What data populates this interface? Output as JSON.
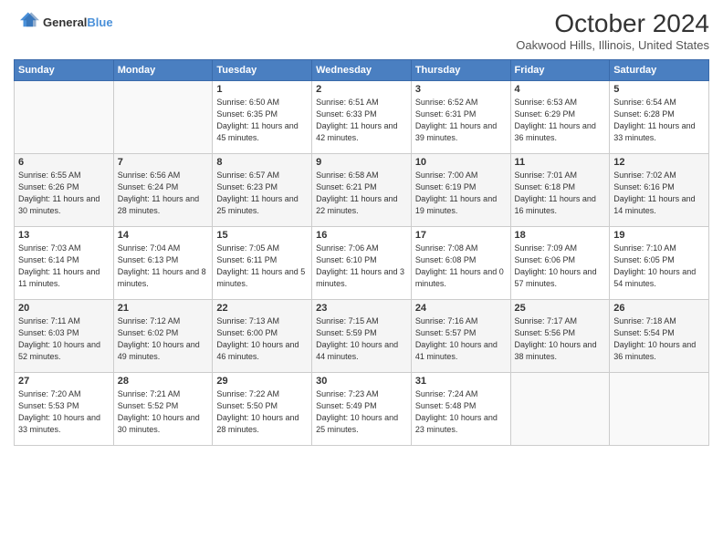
{
  "logo": {
    "line1": "General",
    "line2": "Blue"
  },
  "title": "October 2024",
  "subtitle": "Oakwood Hills, Illinois, United States",
  "days_of_week": [
    "Sunday",
    "Monday",
    "Tuesday",
    "Wednesday",
    "Thursday",
    "Friday",
    "Saturday"
  ],
  "weeks": [
    [
      {
        "day": "",
        "info": ""
      },
      {
        "day": "",
        "info": ""
      },
      {
        "day": "1",
        "info": "Sunrise: 6:50 AM\nSunset: 6:35 PM\nDaylight: 11 hours and 45 minutes."
      },
      {
        "day": "2",
        "info": "Sunrise: 6:51 AM\nSunset: 6:33 PM\nDaylight: 11 hours and 42 minutes."
      },
      {
        "day": "3",
        "info": "Sunrise: 6:52 AM\nSunset: 6:31 PM\nDaylight: 11 hours and 39 minutes."
      },
      {
        "day": "4",
        "info": "Sunrise: 6:53 AM\nSunset: 6:29 PM\nDaylight: 11 hours and 36 minutes."
      },
      {
        "day": "5",
        "info": "Sunrise: 6:54 AM\nSunset: 6:28 PM\nDaylight: 11 hours and 33 minutes."
      }
    ],
    [
      {
        "day": "6",
        "info": "Sunrise: 6:55 AM\nSunset: 6:26 PM\nDaylight: 11 hours and 30 minutes."
      },
      {
        "day": "7",
        "info": "Sunrise: 6:56 AM\nSunset: 6:24 PM\nDaylight: 11 hours and 28 minutes."
      },
      {
        "day": "8",
        "info": "Sunrise: 6:57 AM\nSunset: 6:23 PM\nDaylight: 11 hours and 25 minutes."
      },
      {
        "day": "9",
        "info": "Sunrise: 6:58 AM\nSunset: 6:21 PM\nDaylight: 11 hours and 22 minutes."
      },
      {
        "day": "10",
        "info": "Sunrise: 7:00 AM\nSunset: 6:19 PM\nDaylight: 11 hours and 19 minutes."
      },
      {
        "day": "11",
        "info": "Sunrise: 7:01 AM\nSunset: 6:18 PM\nDaylight: 11 hours and 16 minutes."
      },
      {
        "day": "12",
        "info": "Sunrise: 7:02 AM\nSunset: 6:16 PM\nDaylight: 11 hours and 14 minutes."
      }
    ],
    [
      {
        "day": "13",
        "info": "Sunrise: 7:03 AM\nSunset: 6:14 PM\nDaylight: 11 hours and 11 minutes."
      },
      {
        "day": "14",
        "info": "Sunrise: 7:04 AM\nSunset: 6:13 PM\nDaylight: 11 hours and 8 minutes."
      },
      {
        "day": "15",
        "info": "Sunrise: 7:05 AM\nSunset: 6:11 PM\nDaylight: 11 hours and 5 minutes."
      },
      {
        "day": "16",
        "info": "Sunrise: 7:06 AM\nSunset: 6:10 PM\nDaylight: 11 hours and 3 minutes."
      },
      {
        "day": "17",
        "info": "Sunrise: 7:08 AM\nSunset: 6:08 PM\nDaylight: 11 hours and 0 minutes."
      },
      {
        "day": "18",
        "info": "Sunrise: 7:09 AM\nSunset: 6:06 PM\nDaylight: 10 hours and 57 minutes."
      },
      {
        "day": "19",
        "info": "Sunrise: 7:10 AM\nSunset: 6:05 PM\nDaylight: 10 hours and 54 minutes."
      }
    ],
    [
      {
        "day": "20",
        "info": "Sunrise: 7:11 AM\nSunset: 6:03 PM\nDaylight: 10 hours and 52 minutes."
      },
      {
        "day": "21",
        "info": "Sunrise: 7:12 AM\nSunset: 6:02 PM\nDaylight: 10 hours and 49 minutes."
      },
      {
        "day": "22",
        "info": "Sunrise: 7:13 AM\nSunset: 6:00 PM\nDaylight: 10 hours and 46 minutes."
      },
      {
        "day": "23",
        "info": "Sunrise: 7:15 AM\nSunset: 5:59 PM\nDaylight: 10 hours and 44 minutes."
      },
      {
        "day": "24",
        "info": "Sunrise: 7:16 AM\nSunset: 5:57 PM\nDaylight: 10 hours and 41 minutes."
      },
      {
        "day": "25",
        "info": "Sunrise: 7:17 AM\nSunset: 5:56 PM\nDaylight: 10 hours and 38 minutes."
      },
      {
        "day": "26",
        "info": "Sunrise: 7:18 AM\nSunset: 5:54 PM\nDaylight: 10 hours and 36 minutes."
      }
    ],
    [
      {
        "day": "27",
        "info": "Sunrise: 7:20 AM\nSunset: 5:53 PM\nDaylight: 10 hours and 33 minutes."
      },
      {
        "day": "28",
        "info": "Sunrise: 7:21 AM\nSunset: 5:52 PM\nDaylight: 10 hours and 30 minutes."
      },
      {
        "day": "29",
        "info": "Sunrise: 7:22 AM\nSunset: 5:50 PM\nDaylight: 10 hours and 28 minutes."
      },
      {
        "day": "30",
        "info": "Sunrise: 7:23 AM\nSunset: 5:49 PM\nDaylight: 10 hours and 25 minutes."
      },
      {
        "day": "31",
        "info": "Sunrise: 7:24 AM\nSunset: 5:48 PM\nDaylight: 10 hours and 23 minutes."
      },
      {
        "day": "",
        "info": ""
      },
      {
        "day": "",
        "info": ""
      }
    ]
  ]
}
